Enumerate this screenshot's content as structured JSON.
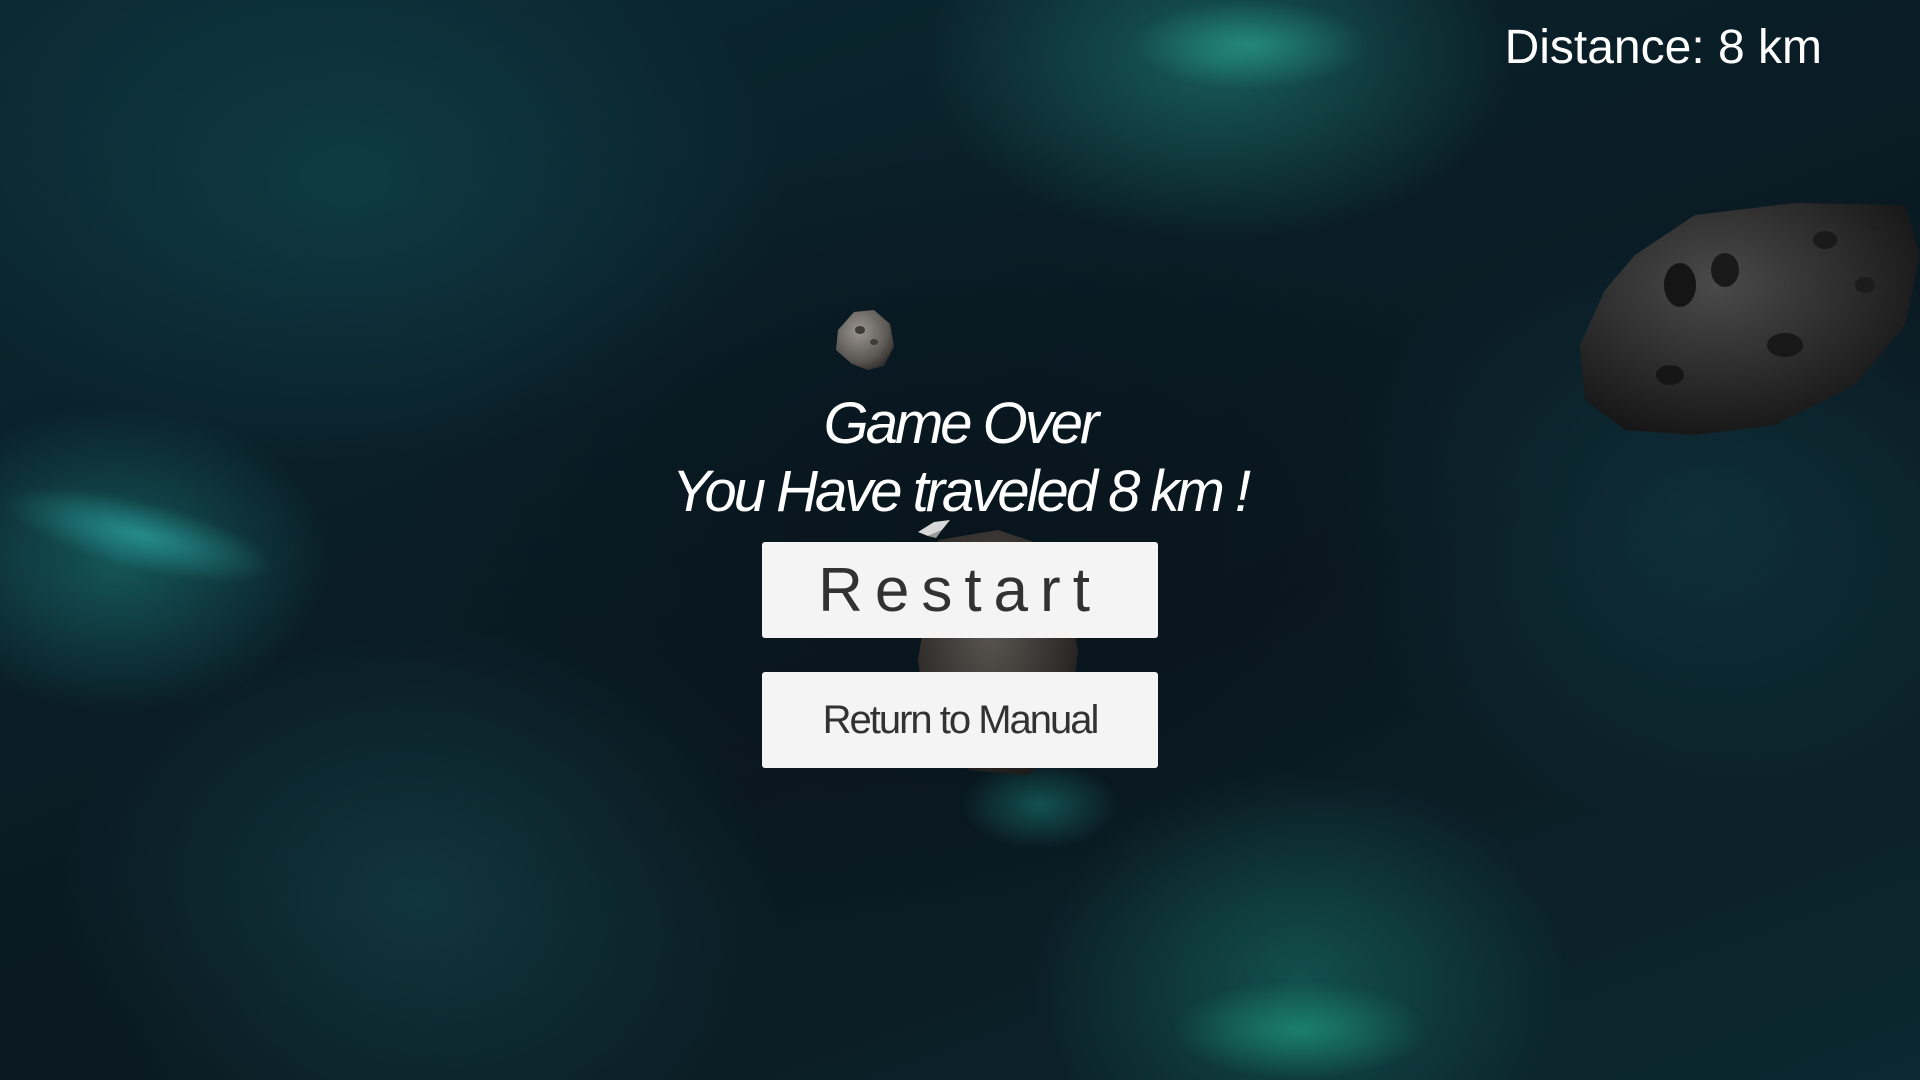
{
  "hud": {
    "distance_text": "Distance: 8 km"
  },
  "game_over": {
    "title": "Game Over",
    "message": "You Have traveled 8 km !"
  },
  "buttons": {
    "restart_label": "Restart",
    "manual_label": "Return to Manual"
  },
  "colors": {
    "background": "#0a1d26",
    "nebula": "#1e9682",
    "text": "#ffffff",
    "button_bg": "#f4f4f4",
    "button_text": "#323232"
  },
  "icons": {
    "asteroids": [
      "asteroid-large-icon",
      "asteroid-small-icon",
      "asteroid-behind-buttons-icon"
    ],
    "ship": "spaceship-icon"
  }
}
